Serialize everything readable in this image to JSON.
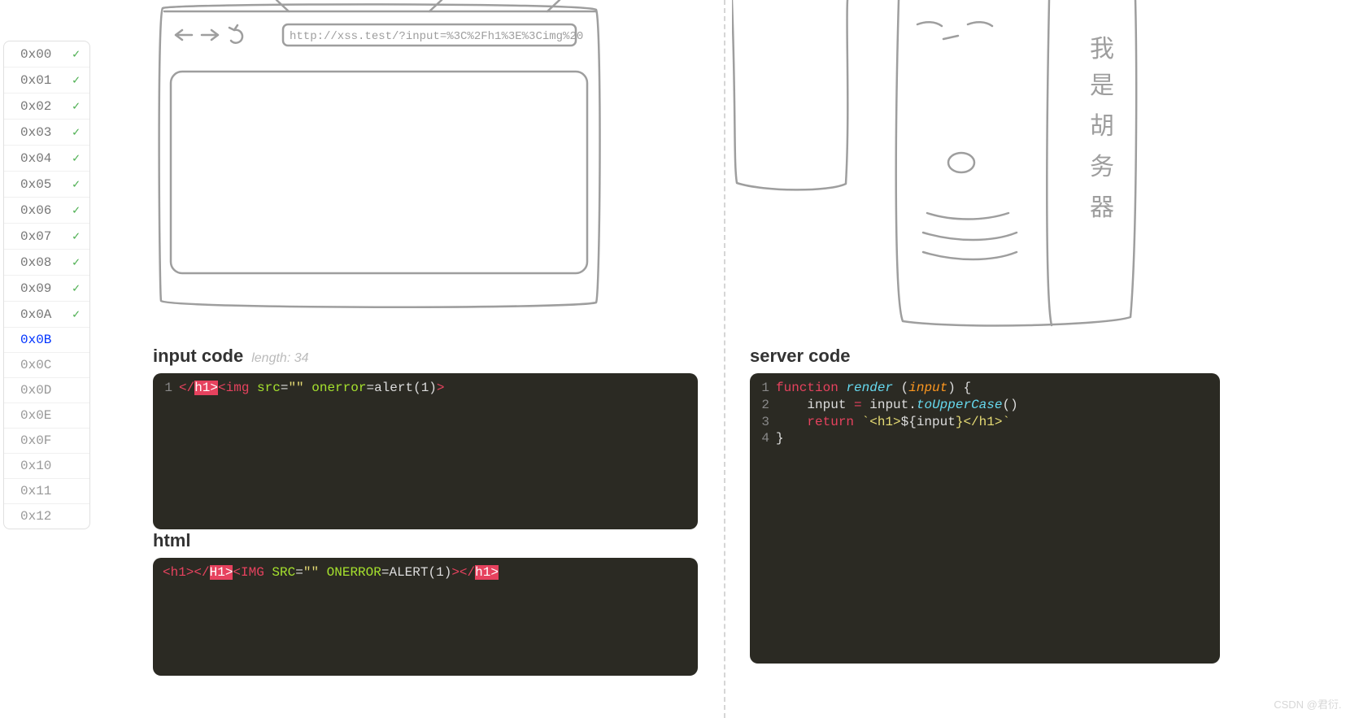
{
  "sidebar": {
    "items": [
      {
        "label": "0x00",
        "done": true,
        "active": false
      },
      {
        "label": "0x01",
        "done": true,
        "active": false
      },
      {
        "label": "0x02",
        "done": true,
        "active": false
      },
      {
        "label": "0x03",
        "done": true,
        "active": false
      },
      {
        "label": "0x04",
        "done": true,
        "active": false
      },
      {
        "label": "0x05",
        "done": true,
        "active": false
      },
      {
        "label": "0x06",
        "done": true,
        "active": false
      },
      {
        "label": "0x07",
        "done": true,
        "active": false
      },
      {
        "label": "0x08",
        "done": true,
        "active": false
      },
      {
        "label": "0x09",
        "done": true,
        "active": false
      },
      {
        "label": "0x0A",
        "done": true,
        "active": false
      },
      {
        "label": "0x0B",
        "done": false,
        "active": true
      },
      {
        "label": "0x0C",
        "done": false,
        "active": false
      },
      {
        "label": "0x0D",
        "done": false,
        "active": false
      },
      {
        "label": "0x0E",
        "done": false,
        "active": false
      },
      {
        "label": "0x0F",
        "done": false,
        "active": false
      },
      {
        "label": "0x10",
        "done": false,
        "active": false
      },
      {
        "label": "0x11",
        "done": false,
        "active": false
      },
      {
        "label": "0x12",
        "done": false,
        "active": false
      }
    ],
    "check_glyph": "✓"
  },
  "browser": {
    "url": "http://xss.test/?input=%3C%2Fh1%3E%3Cimg%20"
  },
  "server_drawing": {
    "label_chars": [
      "我",
      "是",
      "胡",
      "务",
      "器"
    ]
  },
  "input_section": {
    "title": "input code",
    "length_hint": "length: 34",
    "line_no": "1",
    "tokens": {
      "open_close_bracket": "</",
      "h1": "h1",
      "close_bracket": ">",
      "img_tag": "<img",
      "src_attr": " src",
      "eq": "=",
      "quote": "\"\"",
      "onerror_attr": " onerror",
      "alert": "alert",
      "paren_open": "(",
      "one": "1",
      "paren_close": ")",
      "end": ">"
    }
  },
  "html_section": {
    "title": "html",
    "tokens": {
      "h1_open": "<h1>",
      "close_open": "</",
      "H1": "H1",
      "close_bracket": ">",
      "IMG": "<IMG",
      "SRC": " SRC",
      "eq": "=",
      "quote": "\"\"",
      "ONERROR": " ONERROR",
      "ALERT": "ALERT",
      "paren_open": "(",
      "one": "1",
      "paren_close": ")",
      "end": ">",
      "h1_close_open": "</",
      "h1_low": "h1",
      "h1_close_end": ">"
    }
  },
  "server_section": {
    "title": "server code",
    "lines": {
      "l1": {
        "no": "1",
        "function": "function",
        "render": "render",
        "paren_open": " (",
        "input": "input",
        "paren_close_brace": ") {"
      },
      "l2": {
        "no": "2",
        "indent": "    ",
        "input1": "input",
        "eq": " = ",
        "input2": "input",
        "dot": ".",
        "method": "toUpperCase",
        "call": "()"
      },
      "l3": {
        "no": "3",
        "indent": "    ",
        "return": "return",
        "tick_open": " `<h1>",
        "dollar": "${",
        "input": "input",
        "close": "}</h1>`"
      },
      "l4": {
        "no": "4",
        "brace": "}"
      }
    }
  },
  "watermark": "CSDN @君衍.⠀"
}
